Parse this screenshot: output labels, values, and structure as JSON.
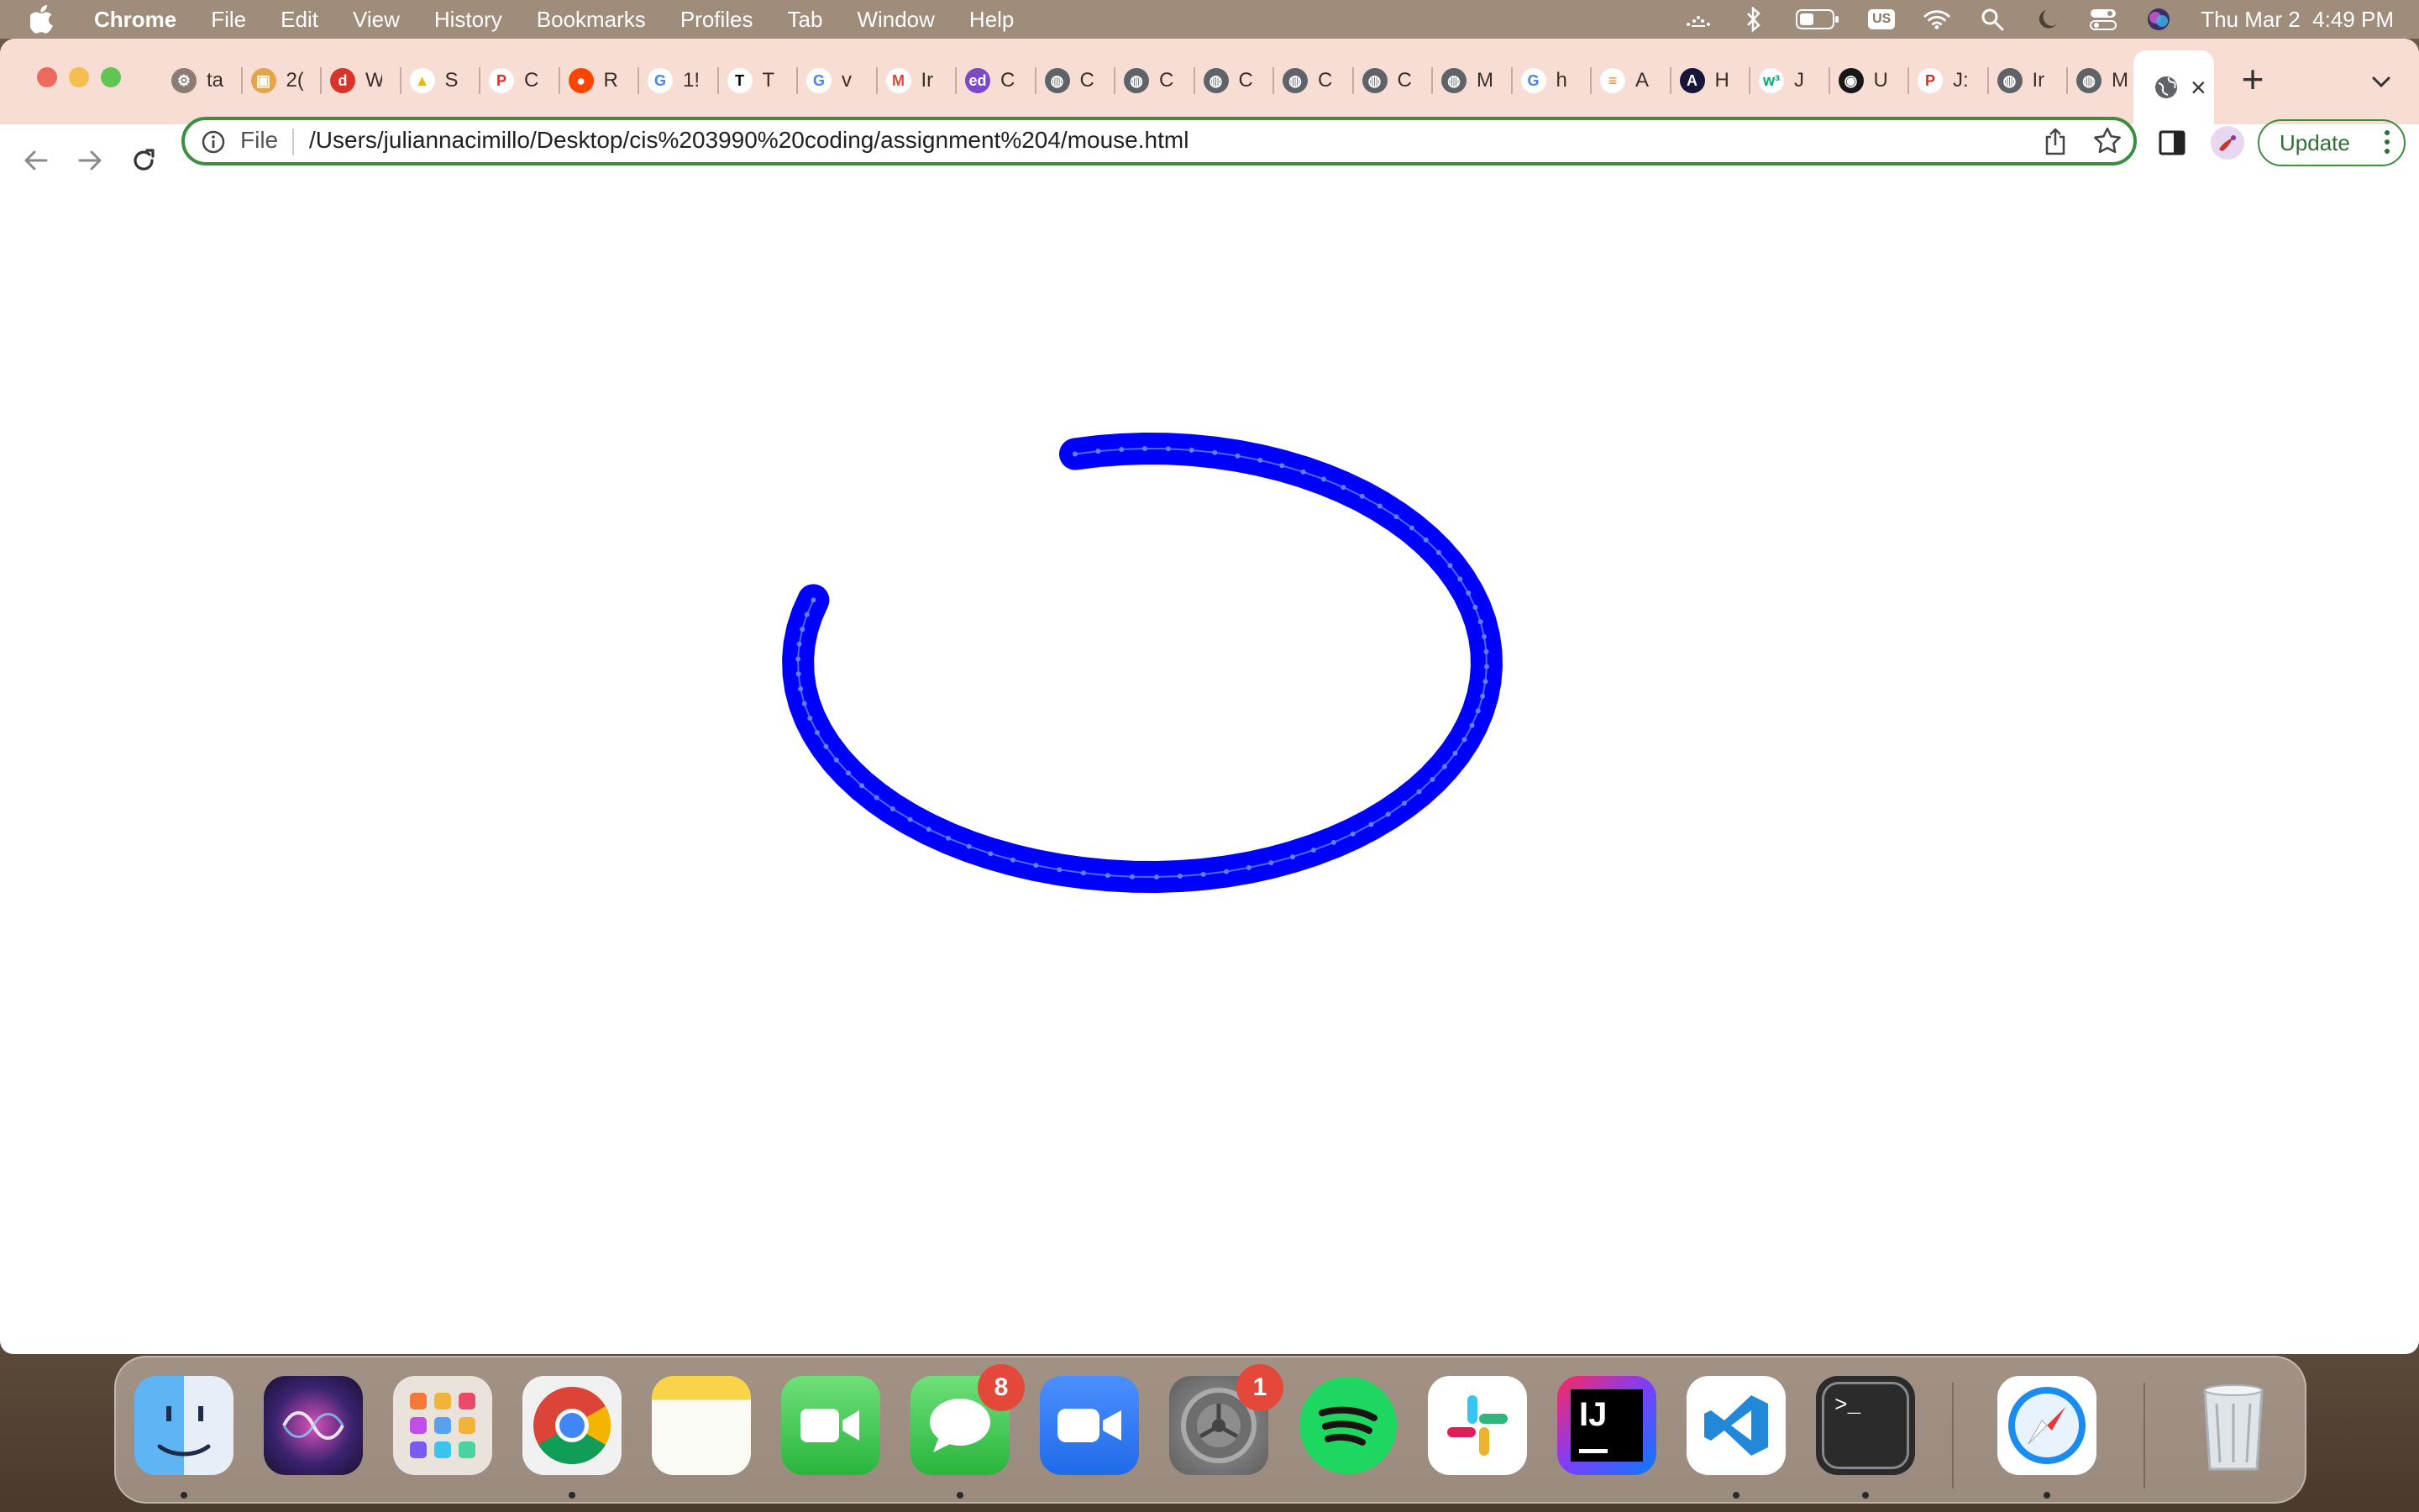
{
  "system_menubar": {
    "app_name": "Chrome",
    "menus": [
      "File",
      "Edit",
      "View",
      "History",
      "Bookmarks",
      "Profiles",
      "Tab",
      "Window",
      "Help"
    ],
    "status_icons": [
      "keyboard-brightness-icon",
      "bluetooth-icon",
      "battery-icon",
      "input-source-us-icon",
      "wifi-icon",
      "spotlight-search-icon",
      "focus-moon-icon",
      "control-center-icon",
      "siri-icon"
    ],
    "input_source_label": "US",
    "datetime": "Thu Mar 2  4:49 PM"
  },
  "browser": {
    "tabs": [
      {
        "label": "ta",
        "favicon": "gear-icon"
      },
      {
        "label": "2(",
        "favicon": "box-icon"
      },
      {
        "label": "W",
        "favicon": "red-d-icon"
      },
      {
        "label": "S",
        "favicon": "google-drive-icon"
      },
      {
        "label": "C",
        "favicon": "p-circle-icon"
      },
      {
        "label": "R",
        "favicon": "reddit-icon"
      },
      {
        "label": "1!",
        "favicon": "google-icon"
      },
      {
        "label": "T",
        "favicon": "nyt-icon"
      },
      {
        "label": "v",
        "favicon": "google-icon"
      },
      {
        "label": "Ir",
        "favicon": "gmail-icon"
      },
      {
        "label": "C",
        "favicon": "ed-icon"
      },
      {
        "label": "C",
        "favicon": "globe-icon"
      },
      {
        "label": "C",
        "favicon": "globe-icon"
      },
      {
        "label": "C",
        "favicon": "globe-icon"
      },
      {
        "label": "C",
        "favicon": "globe-icon"
      },
      {
        "label": "C",
        "favicon": "globe-icon"
      },
      {
        "label": "M",
        "favicon": "globe-icon"
      },
      {
        "label": "h",
        "favicon": "google-icon"
      },
      {
        "label": "A",
        "favicon": "stack-overflow-icon"
      },
      {
        "label": "H",
        "favicon": "dark-a-icon"
      },
      {
        "label": "J",
        "favicon": "w3-icon"
      },
      {
        "label": "U",
        "favicon": "github-icon"
      },
      {
        "label": "J:",
        "favicon": "p-circle-icon"
      },
      {
        "label": "Ir",
        "favicon": "globe-icon"
      },
      {
        "label": "M",
        "favicon": "globe-icon"
      }
    ],
    "active_tab": {
      "favicon": "globe-icon",
      "close": "×"
    },
    "new_tab": "+",
    "omnibox": {
      "scheme_label": "File",
      "url": "/Users/juliannacimillo/Desktop/cis%203990%20coding/assignment%204/mouse.html"
    },
    "update_button": "Update"
  },
  "canvas": {
    "stroke_color": "#0000ff",
    "stroke_description": "blue mouse-drawn arc",
    "point_color": "#5b82ff"
  },
  "dock": {
    "apps": [
      {
        "name": "Finder",
        "icon": "finder-icon",
        "running": true
      },
      {
        "name": "Siri",
        "icon": "siri-icon",
        "running": false
      },
      {
        "name": "Launchpad",
        "icon": "launchpad-icon",
        "running": false
      },
      {
        "name": "Google Chrome",
        "icon": "chrome-icon",
        "running": true
      },
      {
        "name": "Notes",
        "icon": "notes-icon",
        "running": false
      },
      {
        "name": "FaceTime",
        "icon": "facetime-icon",
        "running": false
      },
      {
        "name": "Messages",
        "icon": "messages-icon",
        "running": true,
        "badge": "8"
      },
      {
        "name": "Zoom",
        "icon": "zoom-icon",
        "running": false
      },
      {
        "name": "System Preferences",
        "icon": "system-preferences-icon",
        "running": false,
        "badge": "1"
      },
      {
        "name": "Spotify",
        "icon": "spotify-icon",
        "running": false
      },
      {
        "name": "Slack",
        "icon": "slack-icon",
        "running": false
      },
      {
        "name": "IntelliJ IDEA",
        "icon": "intellij-icon",
        "running": false,
        "glyph": "IJ"
      },
      {
        "name": "Visual Studio Code",
        "icon": "vscode-icon",
        "running": true
      },
      {
        "name": "Terminal",
        "icon": "terminal-icon",
        "running": true,
        "glyph": ">_"
      },
      {
        "name": "Safari",
        "icon": "safari-icon",
        "running": true
      },
      {
        "name": "Trash",
        "icon": "trash-icon",
        "running": false
      }
    ]
  }
}
